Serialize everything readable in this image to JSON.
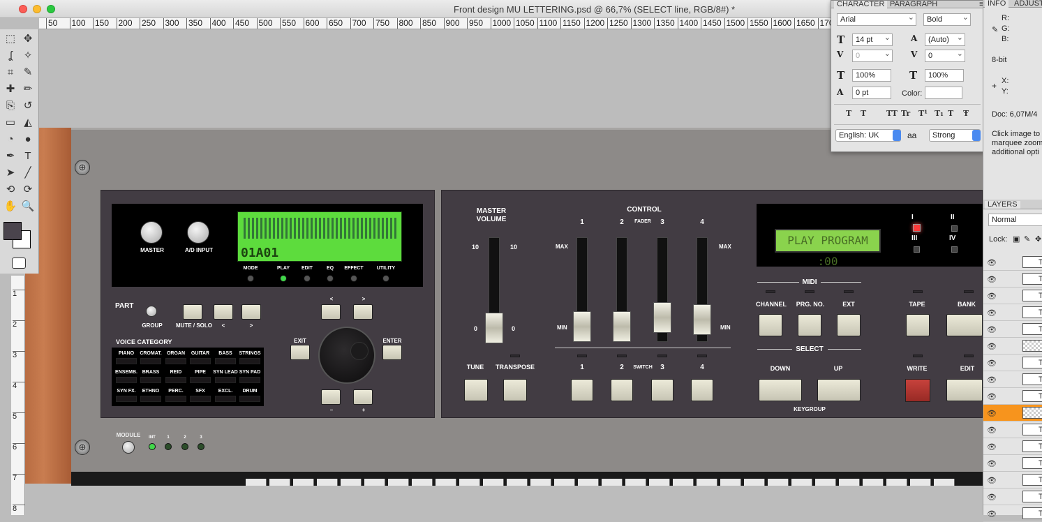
{
  "window": {
    "title": "Front design MU LETTERING.psd @ 66,7% (SELECT line, RGB/8#) *"
  },
  "ruler": {
    "ticks": [
      "50",
      "100",
      "150",
      "200",
      "250",
      "300",
      "350",
      "400",
      "450",
      "500",
      "550",
      "600",
      "650",
      "700",
      "750",
      "800",
      "850",
      "900",
      "950",
      "1000",
      "1050",
      "1100",
      "1150",
      "1200",
      "1250",
      "1300",
      "1350",
      "1400",
      "1450",
      "1500",
      "1550",
      "1600",
      "1650",
      "170"
    ],
    "vticks": [
      "1",
      "2",
      "3",
      "4",
      "5",
      "6",
      "7",
      "8"
    ]
  },
  "tools": [
    "marquee-icon",
    "move-icon",
    "lasso-icon",
    "magic-wand-icon",
    "crop-icon",
    "eyedropper-icon",
    "healing-icon",
    "brush-icon",
    "stamp-icon",
    "history-brush-icon",
    "eraser-icon",
    "paint-bucket-icon",
    "blur-icon",
    "dodge-icon",
    "pen-icon",
    "type-icon",
    "path-select-icon",
    "line-icon",
    "3d-rotate-icon",
    "3d-orbit-icon",
    "hand-icon",
    "zoom-icon"
  ],
  "tool_glyphs": [
    "⬚",
    "✥",
    "ʆ",
    "✧",
    "⌗",
    "✎",
    "✚",
    "✏",
    "⎘",
    "↺",
    "▭",
    "◭",
    "◔",
    "●",
    "✒",
    "T",
    "➤",
    "╱",
    "⟲",
    "⟳",
    "✋",
    "🔍"
  ],
  "colors": {
    "foreground": "#4a444d",
    "background": "#ffffff",
    "accent": "#f7941d"
  },
  "synth": {
    "master_label": "MASTER",
    "ad_label": "A/D INPUT",
    "mode_labels": [
      "MODE",
      "PLAY",
      "EDIT",
      "EQ",
      "EFFECT",
      "UTILITY"
    ],
    "lcd_text": "01A01",
    "part_label": "PART",
    "group_label": "GROUP",
    "mute_label": "MUTE / SOLO",
    "lt": "<",
    "gt": ">",
    "voice_category_label": "VOICE CATEGORY",
    "voice_categories": [
      "PIANO",
      "CROMAT.",
      "ORGAN",
      "GUITAR",
      "BASS",
      "STRINGS",
      "ENSEMB.",
      "BRASS",
      "REID",
      "PIPE",
      "SYN LEAD",
      "SYN PAD",
      "SYN FX.",
      "ETHNO",
      "PERC.",
      "SFX",
      "EXCL.",
      "DRUM"
    ],
    "exit_label": "EXIT",
    "enter_label": "ENTER",
    "minus": "–",
    "plus": "+",
    "module_label": "MODULE",
    "module_leds": [
      "INT",
      "1",
      "2",
      "3"
    ],
    "master_volume_label": "MASTER VOLUME",
    "mv_10": "10",
    "mv_0": "0",
    "control_label": "CONTROL",
    "fader_label": "FADER",
    "switch_label": "SWITCH",
    "fader_numbers": [
      "1",
      "2",
      "3",
      "4"
    ],
    "max_label": "MAX",
    "min_label": "MIN",
    "tune_label": "TUNE",
    "transpose_label": "TRANSPOSE",
    "lcd2_text": "PLAY PROGRAM :00",
    "roman": [
      "I",
      "II",
      "III",
      "IV"
    ],
    "midi_label": "MIDI",
    "channel_label": "CHANNEL",
    "prg_label": "PRG. NO.",
    "ext_label": "EXT",
    "tape_label": "TAPE",
    "bank_label": "BANK",
    "select_label": "SELECT",
    "down_label": "DOWN",
    "up_label": "UP",
    "keygroup_label": "KEYGROUP",
    "write_label": "WRITE",
    "edit_label": "EDIT"
  },
  "character_panel": {
    "tabs": [
      "CHARACTER",
      "PARAGRAPH"
    ],
    "font_family": "Arial",
    "font_style": "Bold",
    "font_size": "14 pt",
    "leading": "(Auto)",
    "kerning": "0",
    "tracking": "0",
    "vscale": "100%",
    "hscale": "100%",
    "baseline": "0 pt",
    "color_label": "Color:",
    "language": "English: UK",
    "aa_icon_label": "aa",
    "antialias": "Strong",
    "style_buttons": [
      "T",
      "T",
      "TT",
      "Tr",
      "T¹",
      "T₁",
      "T",
      "Ŧ"
    ]
  },
  "info_panel": {
    "tabs": [
      "INFO",
      "ADJUST"
    ],
    "r": "R:",
    "g": "G:",
    "b": "B:",
    "bit": "8-bit",
    "x": "X:",
    "y": "Y:",
    "doc": "Doc: 6,07M/4",
    "hint": "Click image to marquee zoom additional opti"
  },
  "layers_panel": {
    "tab": "LAYERS",
    "blend": "Normal",
    "lock_label": "Lock:",
    "rows": [
      "T",
      "T",
      "T",
      "T",
      "T",
      "",
      "T",
      "T",
      "T",
      "",
      "T",
      "T",
      "T",
      "T",
      "T",
      "T"
    ]
  }
}
